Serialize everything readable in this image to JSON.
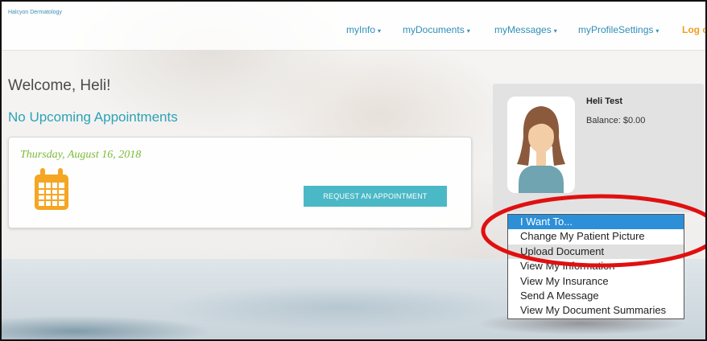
{
  "brand": "Halcyon Dermatology",
  "nav": {
    "items": [
      {
        "label": "myInfo"
      },
      {
        "label": "myDocuments"
      },
      {
        "label": "myMessages"
      },
      {
        "label": "myProfileSettings"
      }
    ],
    "logout_label": "Log o"
  },
  "welcome": "Welcome, Heli!",
  "appointment_status": "No Upcoming Appointments",
  "appointment_card": {
    "date": "Thursday, August 16, 2018",
    "request_button": "REQUEST AN APPOINTMENT",
    "icon": "calendar-icon"
  },
  "profile": {
    "name": "Heli Test",
    "balance": "Balance: $0.00",
    "avatar_icon": "female-avatar"
  },
  "i_want_to": {
    "selected": "I Want To...",
    "options": [
      "I Want To...",
      "Change My Patient Picture",
      "Upload Document",
      "View My Information",
      "View My Insurance",
      "Send A Message",
      "View My Document Summaries"
    ]
  },
  "colors": {
    "nav_link": "#2f8fb8",
    "logout": "#f0a020",
    "accent_teal": "#2aa3b6",
    "button": "#4bb8c6",
    "date_green": "#7dbb38",
    "dropdown_selected": "#2d8fd8",
    "annotation_red": "#e01010"
  }
}
